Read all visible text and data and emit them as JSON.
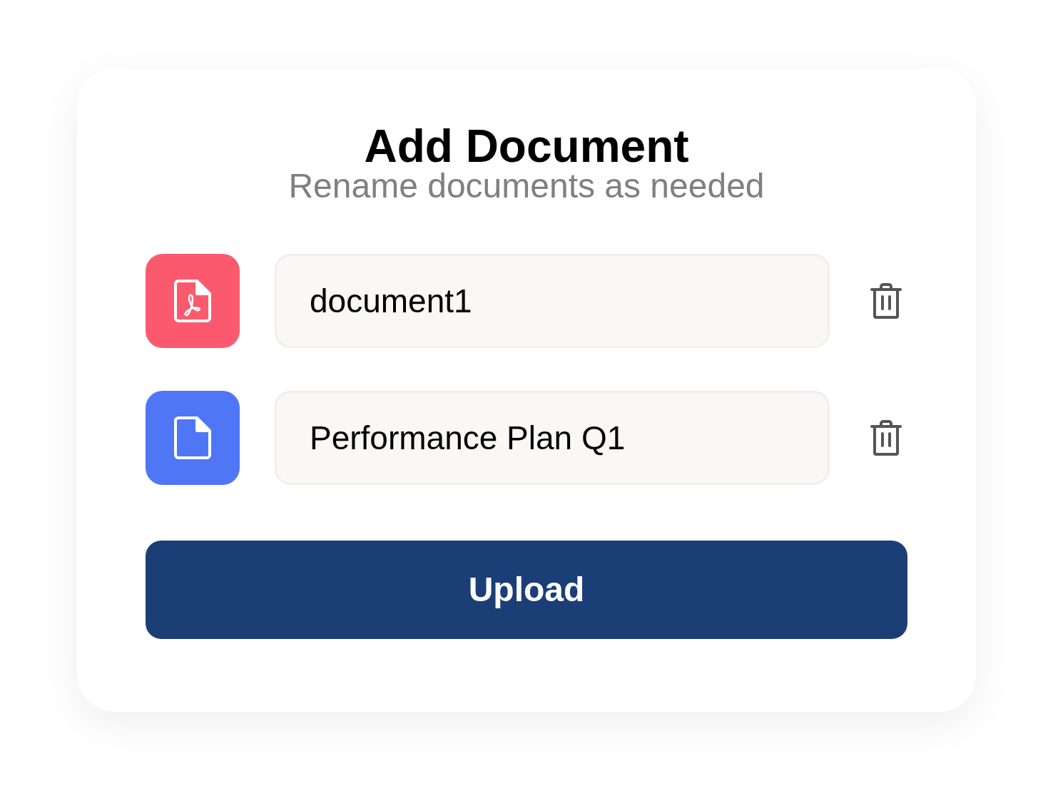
{
  "dialog": {
    "title": "Add Document",
    "subtitle": "Rename documents as needed"
  },
  "documents": [
    {
      "kind": "pdf",
      "color": "#fb5a6e",
      "name": "document1"
    },
    {
      "kind": "generic",
      "color": "#4f77f5",
      "name": "Performance Plan Q1"
    }
  ],
  "primary_button": {
    "label": "Upload"
  }
}
